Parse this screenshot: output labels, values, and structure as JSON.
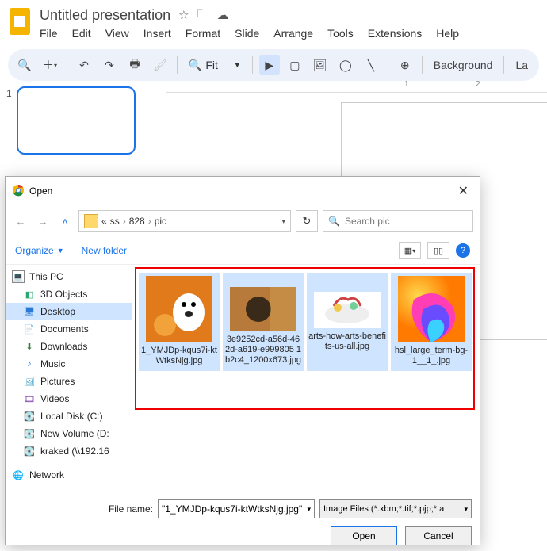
{
  "gs": {
    "title": "Untitled presentation",
    "menu": [
      "File",
      "Edit",
      "View",
      "Insert",
      "Format",
      "Slide",
      "Arrange",
      "Tools",
      "Extensions",
      "Help"
    ],
    "fit": "Fit",
    "background": "Background",
    "layout": "La",
    "slideNumber": "1",
    "rulerMarks": [
      "1",
      "2"
    ]
  },
  "dialog": {
    "title": "Open",
    "path": {
      "prefix": "«",
      "parts": [
        "ss",
        "828",
        "pic"
      ]
    },
    "search_placeholder": "Search pic",
    "organize": "Organize",
    "newfolder": "New folder",
    "tree": [
      {
        "label": "This PC",
        "icon": "pc"
      },
      {
        "label": "3D Objects",
        "icon": "3d"
      },
      {
        "label": "Desktop",
        "icon": "desktop",
        "selected": true
      },
      {
        "label": "Documents",
        "icon": "doc"
      },
      {
        "label": "Downloads",
        "icon": "dl"
      },
      {
        "label": "Music",
        "icon": "music"
      },
      {
        "label": "Pictures",
        "icon": "pic"
      },
      {
        "label": "Videos",
        "icon": "vid"
      },
      {
        "label": "Local Disk (C:)",
        "icon": "disk"
      },
      {
        "label": "New Volume (D:",
        "icon": "disk"
      },
      {
        "label": "kraked (\\\\192.16",
        "icon": "disk"
      },
      {
        "label": "Network",
        "icon": "net"
      }
    ],
    "files": [
      {
        "name": "1_YMJDp-kqus7i-ktWtksNjg.jpg"
      },
      {
        "name": "3e9252cd-a56d-462d-a619-e999805 1b2c4_1200x673.jpg"
      },
      {
        "name": "arts-how-arts-benefits-us-all.jpg"
      },
      {
        "name": "hsl_large_term-bg-1__1_.jpg"
      }
    ],
    "filename_label": "File name:",
    "filename_value": "\"1_YMJDp-kqus7i-ktWtksNjg.jpg\"",
    "filter": "Image Files (*.xbm;*.tif;*.pjp;*.a",
    "open_btn": "Open",
    "cancel_btn": "Cancel"
  }
}
